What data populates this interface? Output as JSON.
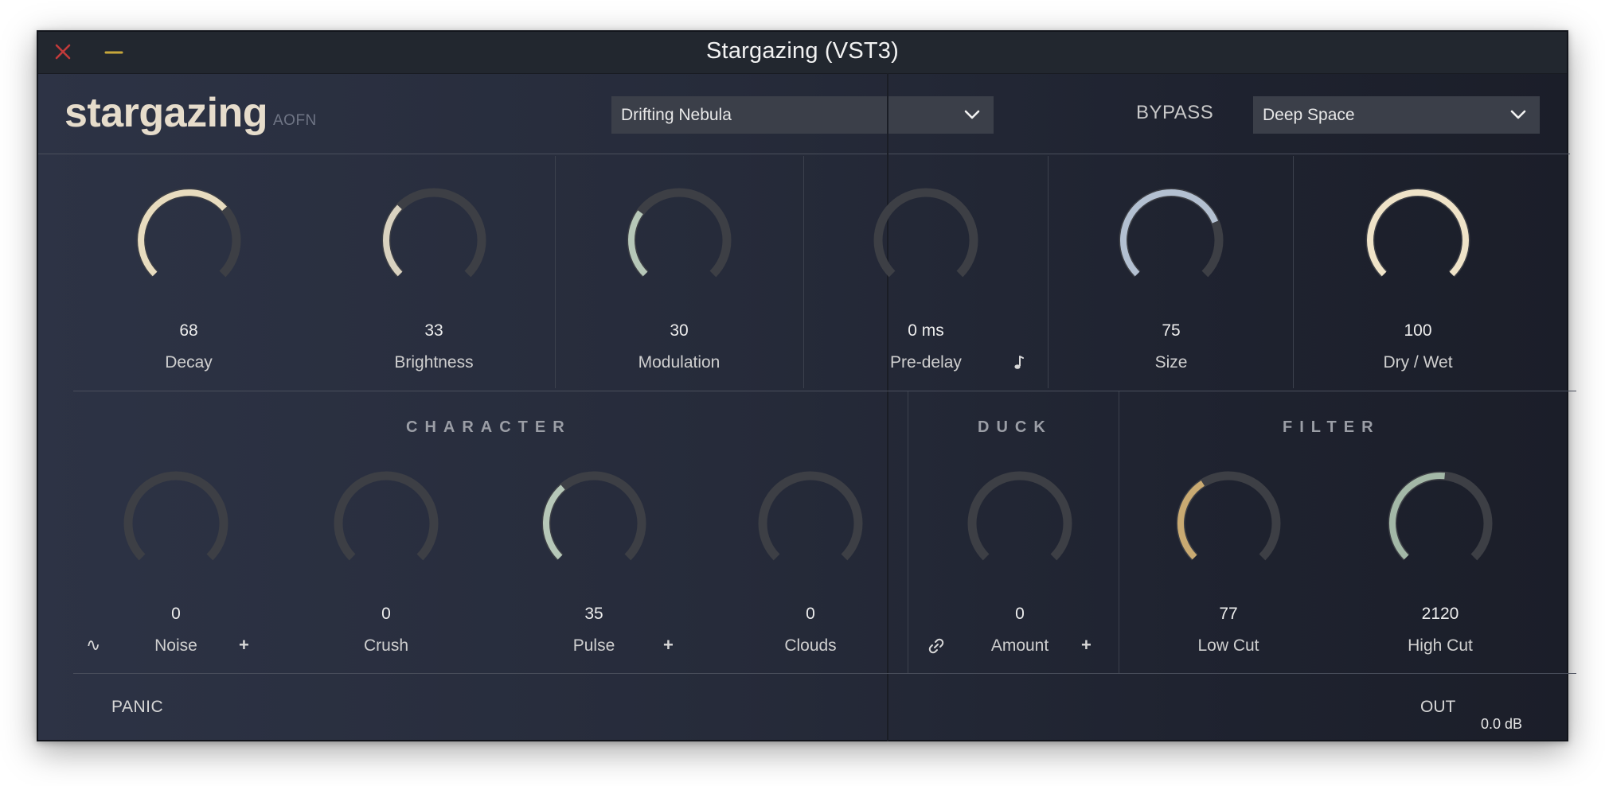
{
  "window": {
    "title": "Stargazing (VST3)"
  },
  "header": {
    "brand": "stargazing",
    "brand_sub": "AOFN",
    "preset": "Drifting Nebula",
    "bypass_label": "BYPASS",
    "mode": "Deep Space"
  },
  "colors": {
    "cream": "#e8dcbf",
    "silver": "#b3c0d1",
    "sage": "#b6c7b8",
    "gold": "#c9aa72",
    "track": "#3d3f45"
  },
  "top_knobs": [
    {
      "value": "68",
      "label": "Decay",
      "fraction": 0.68,
      "color": "#e8dcbf"
    },
    {
      "value": "33",
      "label": "Brightness",
      "fraction": 0.33,
      "color": "#d9d2c0"
    },
    {
      "value": "30",
      "label": "Modulation",
      "fraction": 0.3,
      "color": "#b6c7b8"
    },
    {
      "value": "0 ms",
      "label": "Pre-delay",
      "fraction": 0.0,
      "color": "#e8dcbf",
      "icon": "music-note-icon"
    },
    {
      "value": "75",
      "label": "Size",
      "fraction": 0.75,
      "color": "#b3c0d1"
    },
    {
      "value": "100",
      "label": "Dry / Wet",
      "fraction": 1.0,
      "color": "#efe3c8"
    }
  ],
  "sections": {
    "character": "CHARACTER",
    "duck": "DUCK",
    "filter": "FILTER"
  },
  "bottom_knobs": [
    {
      "value": "0",
      "label": "Noise",
      "fraction": 0.0,
      "color": "#e8dcbf",
      "left_icon": "∿",
      "right_icon": "+"
    },
    {
      "value": "0",
      "label": "Crush",
      "fraction": 0.0,
      "color": "#e8dcbf"
    },
    {
      "value": "35",
      "label": "Pulse",
      "fraction": 0.35,
      "color": "#b6c7b8",
      "right_icon": "+"
    },
    {
      "value": "0",
      "label": "Clouds",
      "fraction": 0.0,
      "color": "#e8dcbf"
    },
    {
      "value": "0",
      "label": "Amount",
      "fraction": 0.0,
      "color": "#e8dcbf",
      "left_icon": "link",
      "right_icon": "+"
    },
    {
      "value": "77",
      "label": "Low Cut",
      "fraction": 0.38,
      "color": "#c9aa72"
    },
    {
      "value": "2120",
      "label": "High Cut",
      "fraction": 0.52,
      "color": "#a3b8a7"
    }
  ],
  "footer": {
    "panic": "PANIC",
    "out_label": "OUT",
    "out_value": "0.0 dB"
  }
}
